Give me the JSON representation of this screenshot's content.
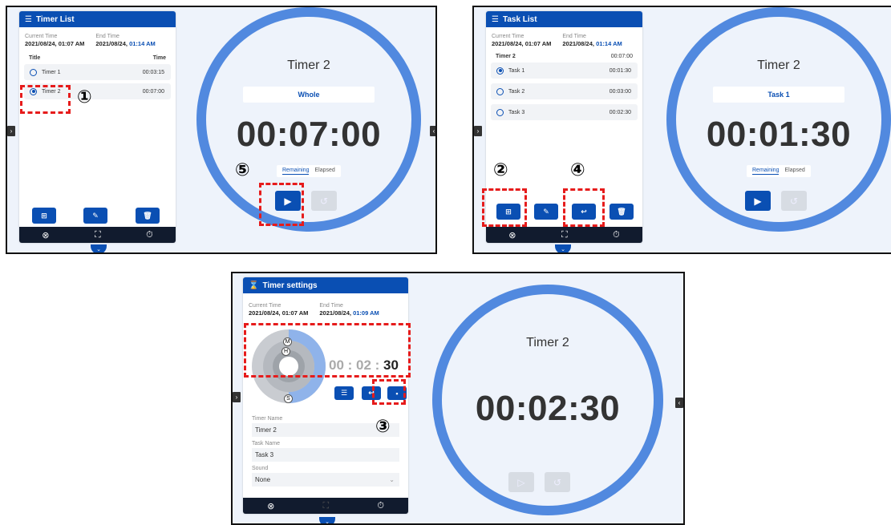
{
  "panel1": {
    "sidebar_title": "Timer List",
    "current_time_label": "Current Time",
    "current_time_value": "2021/08/24, 01:07 AM",
    "end_time_label": "End Time",
    "end_time_date": "2021/08/24, ",
    "end_time_clock": "01:14 AM",
    "col_title": "Title",
    "col_time": "Time",
    "rows": [
      {
        "name": "Timer 1",
        "time": "00:03:15"
      },
      {
        "name": "Timer 2",
        "time": "00:07:00"
      }
    ],
    "timer_title": "Timer 2",
    "pill_label": "Whole",
    "big_time": "00:07:00",
    "toggle_remaining": "Remaining",
    "toggle_elapsed": "Elapsed",
    "marker_1": "①",
    "marker_5": "⑤"
  },
  "panel2": {
    "sidebar_title": "Task List",
    "current_time_label": "Current Time",
    "current_time_value": "2021/08/24, 01:07 AM",
    "end_time_label": "End Time",
    "end_time_date": "2021/08/24, ",
    "end_time_clock": "01:14 AM",
    "col_title": "Timer 2",
    "col_time": "00:07:00",
    "rows": [
      {
        "name": "Task 1",
        "time": "00:01:30"
      },
      {
        "name": "Task 2",
        "time": "00:03:00"
      },
      {
        "name": "Task 3",
        "time": "00:02:30"
      }
    ],
    "timer_title": "Timer 2",
    "pill_label": "Task 1",
    "big_time": "00:01:30",
    "toggle_remaining": "Remaining",
    "toggle_elapsed": "Elapsed",
    "marker_2": "②",
    "marker_4": "④"
  },
  "panel3": {
    "sidebar_title": "Timer settings",
    "current_time_label": "Current Time",
    "current_time_value": "2021/08/24, 01:07 AM",
    "end_time_label": "End Time",
    "end_time_date": "2021/08/24, ",
    "end_time_clock": "01:09 AM",
    "dial_m": "M",
    "dial_h": "H",
    "dial_s": "S",
    "set_time_prefix": "00 : 02 : ",
    "set_time_seconds": "30",
    "timer_name_label": "Timer Name",
    "timer_name_value": "Timer 2",
    "task_name_label": "Task Name",
    "task_name_value": "Task 3",
    "sound_label": "Sound",
    "sound_value": "None",
    "timer_title": "Timer 2",
    "big_time": "00:02:30",
    "marker_3": "③"
  },
  "colors": {
    "accent": "#0a4fb3",
    "ring": "#5189df",
    "highlight_dash": "#e61b1b",
    "background": "#eef3fb"
  },
  "icons": [
    "list-icon",
    "plus-icon",
    "pencil-icon",
    "trash-icon",
    "undo-icon",
    "save-icon",
    "close-icon",
    "fullscreen-icon",
    "timer-icon",
    "play-icon",
    "reset-icon",
    "chevron-right-icon",
    "chevron-left-icon",
    "chevron-down-icon",
    "hourglass-icon"
  ]
}
